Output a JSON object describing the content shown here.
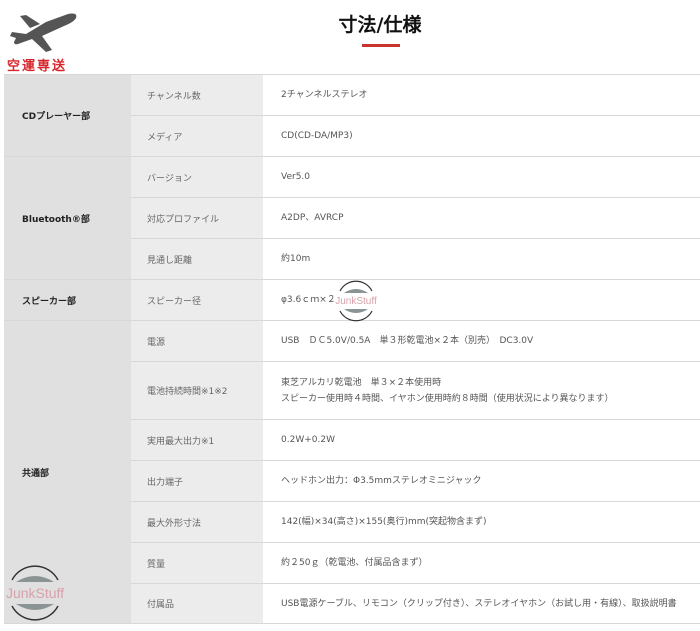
{
  "logo": {
    "icon": "airplane-icon",
    "text": "空運専送"
  },
  "header": {
    "title": "寸法/仕様",
    "accent_color": "#c8352e"
  },
  "spec_table": {
    "sections": [
      {
        "name": "CDプレーヤー部",
        "rows": [
          {
            "item": "チャンネル数",
            "value": "2チャンネルステレオ"
          },
          {
            "item": "メディア",
            "value": "CD(CD-DA/MP3)"
          }
        ]
      },
      {
        "name": "Bluetooth®部",
        "rows": [
          {
            "item": "バージョン",
            "value": "Ver5.0"
          },
          {
            "item": "対応プロファイル",
            "value": "A2DP、AVRCP"
          },
          {
            "item": "見通し距離",
            "value": "約10m"
          }
        ]
      },
      {
        "name": "スピーカー部",
        "rows": [
          {
            "item": "スピーカー径",
            "value": "φ3.6ｃｍ×２"
          }
        ]
      },
      {
        "name": "共通部",
        "rows": [
          {
            "item": "電源",
            "value": "USB　ＤＣ5.0V/0.5A　単３形乾電池×２本（別売）　DC3.0V"
          },
          {
            "item": "電池持続時間※1※2",
            "value_lines": [
              "東芝アルカリ乾電池　単３×２本使用時",
              "スピーカー使用時４時間、イヤホン使用時約８時間（使用状況により異なります）"
            ]
          },
          {
            "item": "実用最大出力※1",
            "value": "0.2W+0.2W"
          },
          {
            "item": "出力端子",
            "value": "ヘッドホン出力：Φ3.5mmステレオミニジャック"
          },
          {
            "item": "最大外形寸法",
            "value": "142(幅)×34(高さ)×155(奥行)mm(突起物含まず)"
          },
          {
            "item": "質量",
            "value": "約２50ｇ（乾電池、付属品含まず）"
          },
          {
            "item": "付属品",
            "value": "USB電源ケーブル、リモコン（クリップ付き）、ステレオイヤホン（お試し用・有線）、取扱説明書"
          }
        ]
      }
    ]
  },
  "watermarks": [
    {
      "text": "JunkStuff",
      "icon": "watermark-logo-icon"
    },
    {
      "text": "JunkStuff",
      "icon": "watermark-logo-icon"
    }
  ]
}
